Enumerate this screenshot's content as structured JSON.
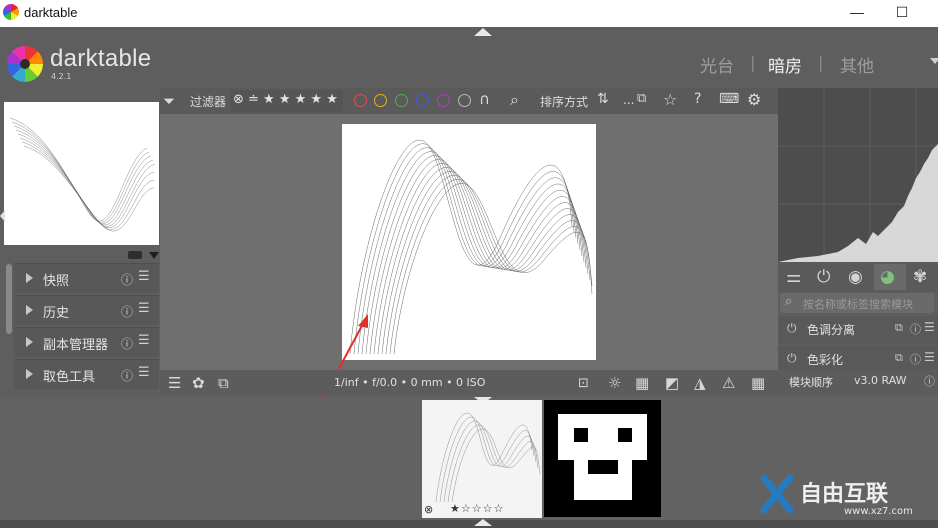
{
  "window": {
    "title": "darktable",
    "minimize": "—",
    "maximize": "☐",
    "close": "✕"
  },
  "header": {
    "brand": "darktable",
    "version": "4.2.1",
    "views": [
      {
        "label": "光台",
        "active": false
      },
      {
        "label": "暗房",
        "active": true
      },
      {
        "label": "其他",
        "active": false
      }
    ],
    "separator": "|"
  },
  "left_panel": {
    "modules": [
      {
        "label": "快照"
      },
      {
        "label": "历史"
      },
      {
        "label": "副本管理器"
      },
      {
        "label": "取色工具"
      }
    ]
  },
  "filter_bar": {
    "filter_label": "过滤器",
    "rating_text": "⊗ ≐ ★ ★ ★ ★ ★",
    "color_labels": [
      {
        "name": "red",
        "color": "#d9534f"
      },
      {
        "name": "yellow",
        "color": "#e0b020"
      },
      {
        "name": "green",
        "color": "#4caf50"
      },
      {
        "name": "blue",
        "color": "#4060d0"
      },
      {
        "name": "purple",
        "color": "#b040c0"
      },
      {
        "name": "gray",
        "color": "#b8b8b8"
      }
    ],
    "sort_label": "排序方式",
    "ellipsis": "..."
  },
  "bottom_toolbar": {
    "exif": "1/inf • f/0.0 • 0 mm • 0 ISO"
  },
  "right_panel": {
    "search_placeholder": "按名称或标签搜索模块",
    "modules": [
      {
        "label": "色调分离"
      },
      {
        "label": "色彩化"
      }
    ],
    "module_order_label": "模块顺序",
    "module_order_value": "v3.0 RAW"
  },
  "filmstrip": {
    "rating": "★☆☆☆☆"
  },
  "watermark": {
    "text": "自由互联",
    "url": "www.xz7.com"
  }
}
